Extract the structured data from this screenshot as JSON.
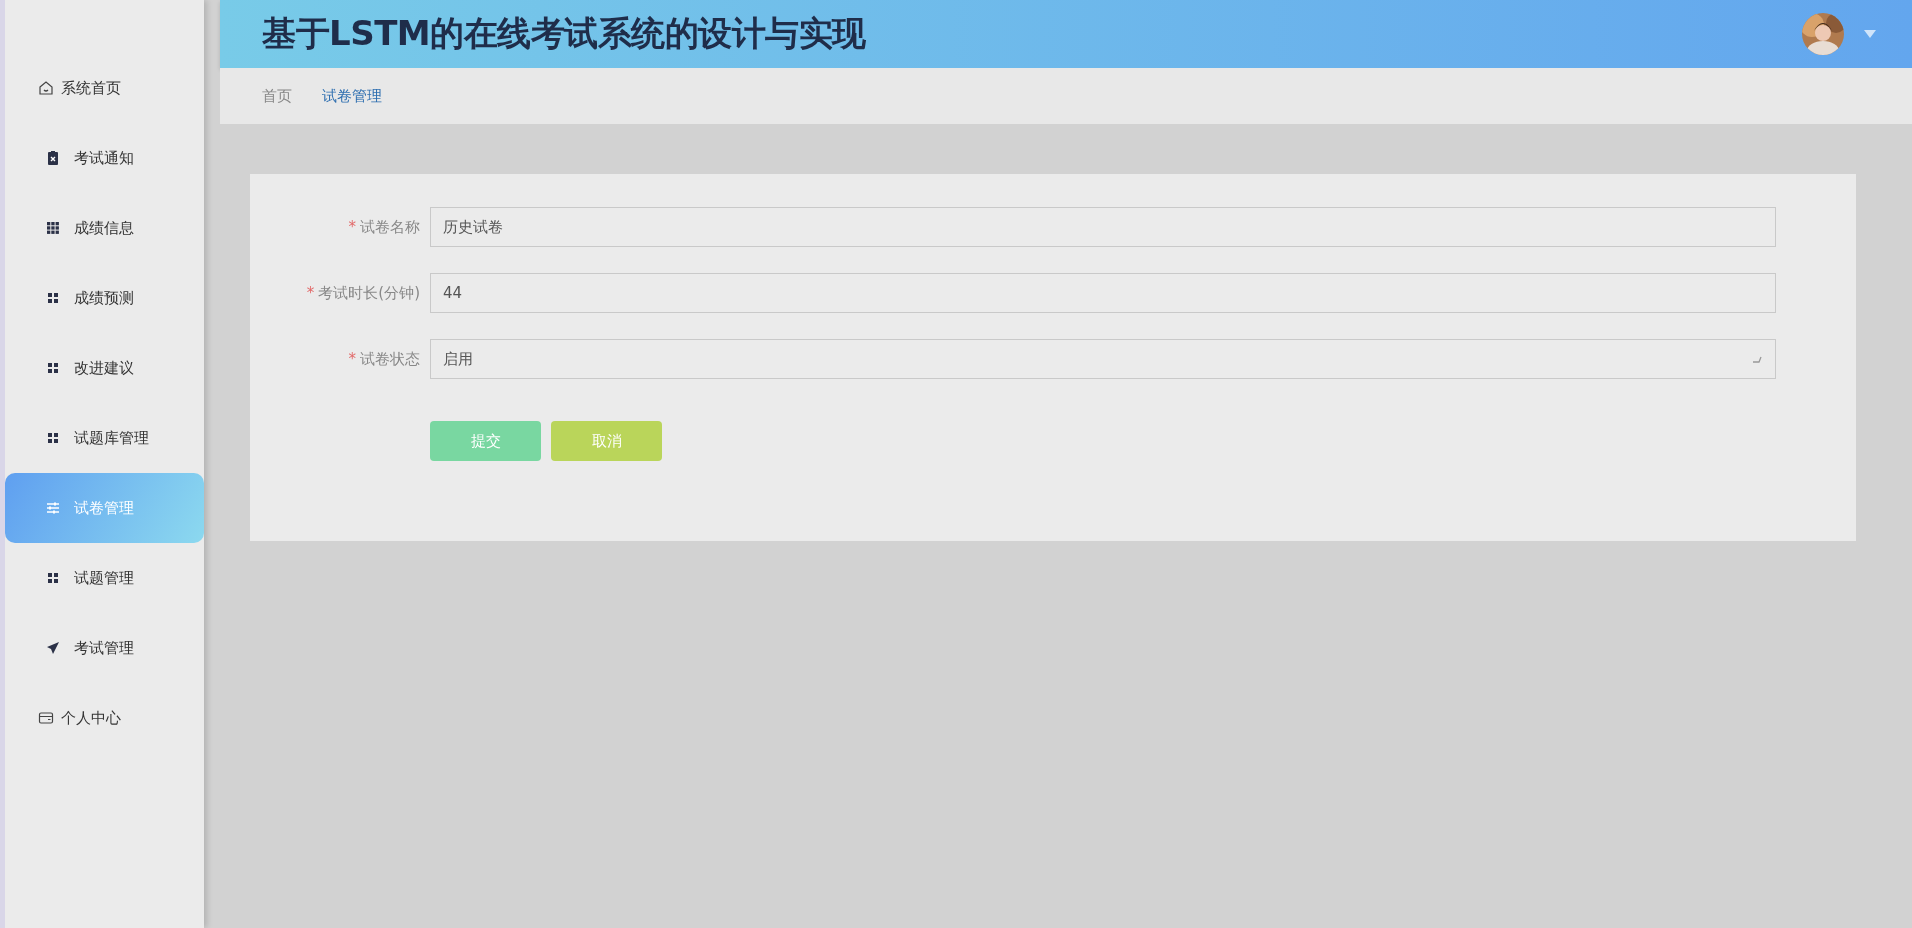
{
  "header": {
    "title": "基于LSTM的在线考试系统的设计与实现"
  },
  "breadcrumb": [
    {
      "label": "首页",
      "selected": false
    },
    {
      "label": "试卷管理",
      "selected": true
    }
  ],
  "sidebar": {
    "items": [
      {
        "label": "系统首页",
        "kind": "top",
        "selected": false
      },
      {
        "label": "考试通知",
        "kind": "sub",
        "selected": false
      },
      {
        "label": "成绩信息",
        "kind": "sub",
        "selected": false
      },
      {
        "label": "成绩预测",
        "kind": "sub",
        "selected": false
      },
      {
        "label": "改进建议",
        "kind": "sub",
        "selected": false
      },
      {
        "label": "试题库管理",
        "kind": "sub",
        "selected": false
      },
      {
        "label": "试卷管理",
        "kind": "sub",
        "selected": true
      },
      {
        "label": "试题管理",
        "kind": "sub",
        "selected": false
      },
      {
        "label": "考试管理",
        "kind": "sub",
        "selected": false
      },
      {
        "label": "个人中心",
        "kind": "top",
        "selected": false
      }
    ]
  },
  "form": {
    "fields": [
      {
        "label": "试卷名称",
        "required_mark": "*",
        "kind": "text",
        "value": "历史试卷"
      },
      {
        "label": "考试时长(分钟)",
        "required_mark": "*",
        "kind": "text",
        "value": "44"
      },
      {
        "label": "试卷状态",
        "required_mark": "*",
        "kind": "select",
        "value": "启用"
      }
    ],
    "buttons": [
      {
        "label": "提交",
        "kind": "submit"
      },
      {
        "label": "取消",
        "kind": "cancel"
      }
    ]
  }
}
